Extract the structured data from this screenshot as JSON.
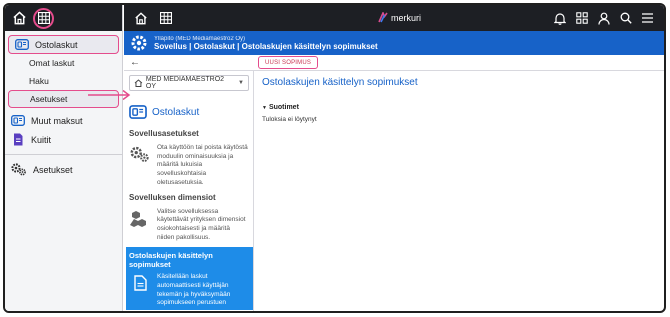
{
  "left_nav": {
    "items": [
      {
        "label": "Ostolaskut",
        "icon": "invoice-icon",
        "highlighted": true
      },
      {
        "label": "Muut maksut",
        "icon": "invoice-icon",
        "highlighted": false
      },
      {
        "label": "Kuitit",
        "icon": "receipt-icon",
        "highlighted": false
      },
      {
        "label": "Asetukset",
        "icon": "gears-icon",
        "highlighted": false
      }
    ],
    "subitems": [
      {
        "label": "Omat laskut",
        "highlighted": false
      },
      {
        "label": "Haku",
        "highlighted": false
      },
      {
        "label": "Asetukset",
        "highlighted": true
      }
    ]
  },
  "topbar": {
    "brand": "merkuri"
  },
  "header": {
    "org": "Ylläpito (MED Mediamaestro2 Oy)",
    "breadcrumb": "Sovellus | Ostolaskut | Ostolaskujen käsittelyn sopimukset"
  },
  "toolbar": {
    "new_button": "UUSI SOPIMUS"
  },
  "sidebar": {
    "company": "MED MEDIAMAESTRO2 OY",
    "app_title": "Ostolaskut",
    "sections": [
      {
        "title": "Sovellusasetukset",
        "text": "Ota käyttöön tai poista käytöstä moduulin ominaisuuksia ja määritä lukuisia sovelluskohtaisia oletusasetuksia."
      },
      {
        "title": "Sovelluksen dimensiot",
        "text": "Valitse sovelluksessa käytettävät yrityksen dimensiot osiokohtaisesti ja määritä niiden pakollisuus."
      },
      {
        "title": "Ostolaskujen käsittelyn sopimukset",
        "text": "Käsitellään laskut automaattisesti käyttäjän tekemän ja hyväksymään sopimukseen perustuen"
      }
    ]
  },
  "main": {
    "title": "Ostolaskujen käsittelyn sopimukset",
    "filters_label": "Suotimet",
    "no_results": "Tuloksia ei löytynyt"
  },
  "colors": {
    "accent": "#1762c8",
    "highlight": "#e44c8c",
    "active_card": "#1e8ce8",
    "dark_bar": "#1d1f24"
  }
}
